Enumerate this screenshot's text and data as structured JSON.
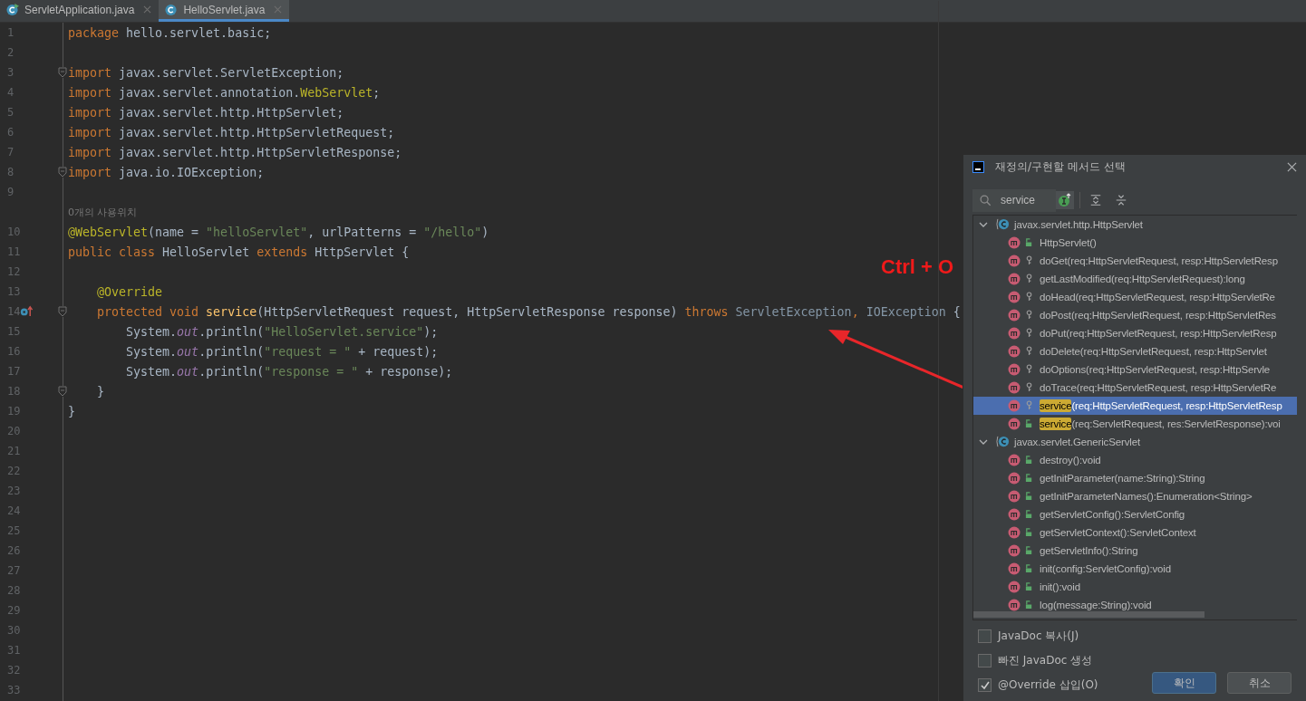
{
  "tabs": [
    {
      "label": "ServletApplication.java",
      "selected": false,
      "kind": "runnable"
    },
    {
      "label": "HelloServlet.java",
      "selected": true,
      "kind": "plain"
    }
  ],
  "editor": {
    "lines": [
      {
        "number": "1",
        "tokens": [
          {
            "kind": "kw",
            "text": "package "
          },
          {
            "kind": "plain",
            "text": "hello.servlet.basic;"
          }
        ]
      },
      {
        "number": "2"
      },
      {
        "number": "3",
        "fold": true,
        "tokens": [
          {
            "kind": "kw",
            "text": "import "
          },
          {
            "kind": "plain",
            "text": "javax.servlet.ServletException;"
          }
        ]
      },
      {
        "number": "4",
        "tokens": [
          {
            "kind": "kw",
            "text": "import "
          },
          {
            "kind": "plain",
            "text": "javax.servlet.annotation."
          },
          {
            "kind": "ann",
            "text": "WebServlet"
          },
          {
            "kind": "plain",
            "text": ";"
          }
        ]
      },
      {
        "number": "5",
        "tokens": [
          {
            "kind": "kw",
            "text": "import "
          },
          {
            "kind": "plain",
            "text": "javax.servlet.http.HttpServlet;"
          }
        ]
      },
      {
        "number": "6",
        "tokens": [
          {
            "kind": "kw",
            "text": "import "
          },
          {
            "kind": "plain",
            "text": "javax.servlet.http.HttpServletRequest;"
          }
        ]
      },
      {
        "number": "7",
        "tokens": [
          {
            "kind": "kw",
            "text": "import "
          },
          {
            "kind": "plain",
            "text": "javax.servlet.http.HttpServletResponse;"
          }
        ]
      },
      {
        "number": "8",
        "fold": true,
        "tokens": [
          {
            "kind": "kw",
            "text": "import "
          },
          {
            "kind": "plain",
            "text": "java.io.IOException;"
          }
        ]
      },
      {
        "number": "9"
      },
      {
        "hint": "0개의 사용위치"
      },
      {
        "number": "10",
        "tokens": [
          {
            "kind": "ann",
            "text": "@WebServlet"
          },
          {
            "kind": "plain",
            "text": "(name = "
          },
          {
            "kind": "str",
            "text": "\"helloServlet\""
          },
          {
            "kind": "plain",
            "text": ", urlPatterns = "
          },
          {
            "kind": "str",
            "text": "\"/hello\""
          },
          {
            "kind": "plain",
            "text": ")"
          }
        ]
      },
      {
        "number": "11",
        "tokens": [
          {
            "kind": "kw",
            "text": "public class "
          },
          {
            "kind": "plain",
            "text": "HelloServlet "
          },
          {
            "kind": "kw",
            "text": "extends "
          },
          {
            "kind": "plain",
            "text": "HttpServlet {"
          }
        ]
      },
      {
        "number": "12"
      },
      {
        "number": "13",
        "tokens": [
          {
            "kind": "ann",
            "text": "    @Override"
          }
        ]
      },
      {
        "number": "14",
        "fold": true,
        "override": true,
        "tokens": [
          {
            "kind": "kw",
            "text": "    protected void "
          },
          {
            "kind": "method",
            "text": "service"
          },
          {
            "kind": "plain",
            "text": "(HttpServletRequest request, HttpServletResponse response) "
          },
          {
            "kind": "kw",
            "text": "throws "
          },
          {
            "kind": "dim",
            "text": "ServletException"
          },
          {
            "kind": "kw",
            "text": ", "
          },
          {
            "kind": "dim",
            "text": "IOException "
          },
          {
            "kind": "plain",
            "text": "{"
          }
        ]
      },
      {
        "number": "15",
        "tokens": [
          {
            "kind": "plain",
            "text": "        System."
          },
          {
            "kind": "static",
            "text": "out"
          },
          {
            "kind": "plain",
            "text": ".println("
          },
          {
            "kind": "str",
            "text": "\"HelloServlet.service\""
          },
          {
            "kind": "plain",
            "text": ");"
          }
        ]
      },
      {
        "number": "16",
        "tokens": [
          {
            "kind": "plain",
            "text": "        System."
          },
          {
            "kind": "static",
            "text": "out"
          },
          {
            "kind": "plain",
            "text": ".println("
          },
          {
            "kind": "str",
            "text": "\"request = \""
          },
          {
            "kind": "plain",
            "text": " + request);"
          }
        ]
      },
      {
        "number": "17",
        "tokens": [
          {
            "kind": "plain",
            "text": "        System."
          },
          {
            "kind": "static",
            "text": "out"
          },
          {
            "kind": "plain",
            "text": ".println("
          },
          {
            "kind": "str",
            "text": "\"response = \""
          },
          {
            "kind": "plain",
            "text": " + response);"
          }
        ]
      },
      {
        "number": "18",
        "fold": true,
        "tokens": [
          {
            "kind": "plain",
            "text": "    }"
          }
        ]
      },
      {
        "number": "19",
        "tokens": [
          {
            "kind": "plain",
            "text": "}"
          }
        ]
      },
      {
        "number": "20"
      },
      {
        "number": "21"
      },
      {
        "number": "22"
      },
      {
        "number": "23"
      },
      {
        "number": "24"
      },
      {
        "number": "25"
      },
      {
        "number": "26"
      },
      {
        "number": "27"
      },
      {
        "number": "28"
      },
      {
        "number": "29"
      },
      {
        "number": "30"
      },
      {
        "number": "31"
      },
      {
        "number": "32"
      },
      {
        "number": "33"
      }
    ]
  },
  "annotation": {
    "text": "Ctrl + O"
  },
  "dialog": {
    "title": "재정의/구현할 메서드 선택",
    "search": {
      "value": "service"
    },
    "groups": [
      {
        "name": "javax.servlet.http.HttpServlet",
        "expanded": true,
        "methods": [
          {
            "kind": "public",
            "selected": false,
            "text": "HttpServlet()"
          },
          {
            "kind": "protected",
            "selected": false,
            "text": "doGet(req:HttpServletRequest, resp:HttpServletResp"
          },
          {
            "kind": "protected",
            "selected": false,
            "text": "getLastModified(req:HttpServletRequest):long"
          },
          {
            "kind": "protected",
            "selected": false,
            "text": "doHead(req:HttpServletRequest, resp:HttpServletRe"
          },
          {
            "kind": "protected",
            "selected": false,
            "text": "doPost(req:HttpServletRequest, resp:HttpServletRes"
          },
          {
            "kind": "protected",
            "selected": false,
            "text": "doPut(req:HttpServletRequest, resp:HttpServletResp"
          },
          {
            "kind": "protected",
            "selected": false,
            "text": "doDelete(req:HttpServletRequest, resp:HttpServlet"
          },
          {
            "kind": "protected",
            "selected": false,
            "text": "doOptions(req:HttpServletRequest, resp:HttpServle"
          },
          {
            "kind": "protected",
            "selected": false,
            "text": "doTrace(req:HttpServletRequest, resp:HttpServletRe"
          },
          {
            "kind": "protected",
            "selected": true,
            "match": "service",
            "text": "(req:HttpServletRequest, resp:HttpServletResp"
          },
          {
            "kind": "public",
            "selected": false,
            "match": "service",
            "text": "(req:ServletRequest, res:ServletResponse):voi"
          }
        ]
      },
      {
        "name": "javax.servlet.GenericServlet",
        "expanded": true,
        "methods": [
          {
            "kind": "public",
            "selected": false,
            "text": "destroy():void"
          },
          {
            "kind": "public",
            "selected": false,
            "text": "getInitParameter(name:String):String"
          },
          {
            "kind": "public",
            "selected": false,
            "text": "getInitParameterNames():Enumeration<String>"
          },
          {
            "kind": "public",
            "selected": false,
            "text": "getServletConfig():ServletConfig"
          },
          {
            "kind": "public",
            "selected": false,
            "text": "getServletContext():ServletContext"
          },
          {
            "kind": "public",
            "selected": false,
            "text": "getServletInfo():String"
          },
          {
            "kind": "public",
            "selected": false,
            "text": "init(config:ServletConfig):void"
          },
          {
            "kind": "public",
            "selected": false,
            "text": "init():void"
          },
          {
            "kind": "public",
            "selected": false,
            "text": "log(message:String):void"
          }
        ]
      }
    ],
    "options": [
      {
        "label": "JavaDoc 복사(J)",
        "checked": false
      },
      {
        "label": "빠진 JavaDoc 생성",
        "checked": false
      },
      {
        "label": "@Override 삽입(O)",
        "checked": true
      }
    ],
    "buttons": [
      {
        "label": "확인",
        "kind": "primary"
      },
      {
        "label": "취소",
        "kind": "normal"
      }
    ]
  }
}
